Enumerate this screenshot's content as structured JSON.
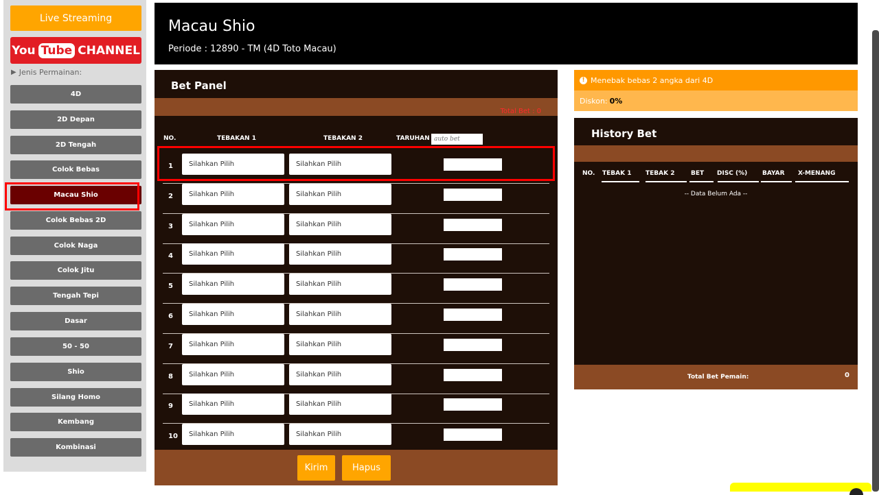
{
  "sidebar": {
    "live_label": "Live Streaming",
    "youtube": {
      "you": "You",
      "tube": "Tube",
      "channel": "CHANNEL"
    },
    "jenis_label": "Jenis Permainan:",
    "items": [
      "4D",
      "2D Depan",
      "2D Tengah",
      "Colok Bebas",
      "Macau Shio",
      "Colok Bebas 2D",
      "Colok Naga",
      "Colok Jitu",
      "Tengah Tepi",
      "Dasar",
      "50 - 50",
      "Shio",
      "Silang Homo",
      "Kembang",
      "Kombinasi"
    ],
    "active_item": "Macau Shio"
  },
  "header": {
    "title": "Macau Shio",
    "periode": "Periode : 12890 - TM (4D Toto Macau)"
  },
  "bet_panel": {
    "title": "Bet Panel",
    "total_bet": "Total Bet : 0",
    "columns": {
      "no": "NO.",
      "tebakan1": "TEBAKAN 1",
      "tebakan2": "TEBAKAN 2",
      "taruhan": "TARUHAN"
    },
    "auto_bet_placeholder": "auto bet",
    "rows": [
      {
        "no": "1",
        "t1": "Silahkan Pilih",
        "t2": "Silahkan Pilih"
      },
      {
        "no": "2",
        "t1": "Silahkan Pilih",
        "t2": "Silahkan Pilih"
      },
      {
        "no": "3",
        "t1": "Silahkan Pilih",
        "t2": "Silahkan Pilih"
      },
      {
        "no": "4",
        "t1": "Silahkan Pilih",
        "t2": "Silahkan Pilih"
      },
      {
        "no": "5",
        "t1": "Silahkan Pilih",
        "t2": "Silahkan Pilih"
      },
      {
        "no": "6",
        "t1": "Silahkan Pilih",
        "t2": "Silahkan Pilih"
      },
      {
        "no": "7",
        "t1": "Silahkan Pilih",
        "t2": "Silahkan Pilih"
      },
      {
        "no": "8",
        "t1": "Silahkan Pilih",
        "t2": "Silahkan Pilih"
      },
      {
        "no": "9",
        "t1": "Silahkan Pilih",
        "t2": "Silahkan Pilih"
      },
      {
        "no": "10",
        "t1": "Silahkan Pilih",
        "t2": "Silahkan Pilih"
      }
    ],
    "kirim_label": "Kirim",
    "hapus_label": "Hapus"
  },
  "info": {
    "description": "Menebak bebas 2 angka dari 4D",
    "diskon_label": "Diskon:",
    "diskon_value": "0%"
  },
  "history": {
    "title": "History Bet",
    "columns": [
      "NO.",
      "TEBAK 1",
      "TEBAK 2",
      "BET",
      "DISC (%)",
      "BAYAR",
      "X-MENANG"
    ],
    "empty": "-- Data Belum Ada --",
    "total_label": "Total Bet Pemain:",
    "total_value": "0"
  },
  "colors": {
    "accent_orange": "#ffa500",
    "panel_dark": "#1e0f07",
    "panel_brown": "#8b4a24",
    "active_menu": "#6a0000",
    "highlight_red": "#ff0000"
  }
}
